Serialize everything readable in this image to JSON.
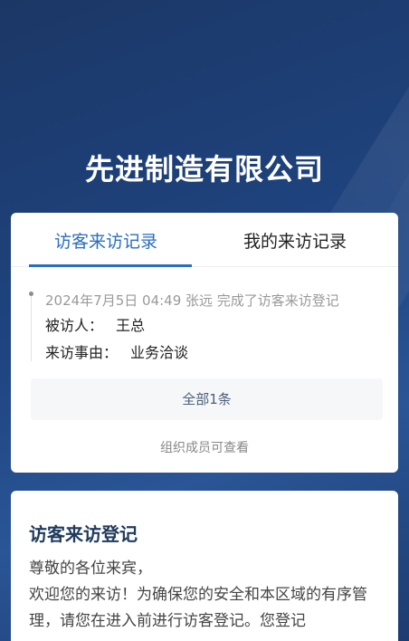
{
  "header": {
    "company_name": "先进制造有限公司"
  },
  "tabs": [
    {
      "label": "访客来访记录",
      "active": true
    },
    {
      "label": "我的来访记录",
      "active": false
    }
  ],
  "records": [
    {
      "meta": "2024年7月5日 04:49  张远 完成了访客来访登记",
      "host_label": "被访人：",
      "host_value": "王总",
      "reason_label": "来访事由：",
      "reason_value": "业务洽谈"
    }
  ],
  "total_button": "全部1条",
  "member_note": "组织成员可查看",
  "registration": {
    "title": "访客来访登记",
    "greeting": "尊敬的各位来宾，",
    "body": "欢迎您的来访！为确保您的安全和本区域的有序管理，请您在进入前进行访客登记。您登记"
  },
  "colors": {
    "accent": "#2a6ebf",
    "title": "#1f3a5c",
    "background": "#1f4480"
  }
}
